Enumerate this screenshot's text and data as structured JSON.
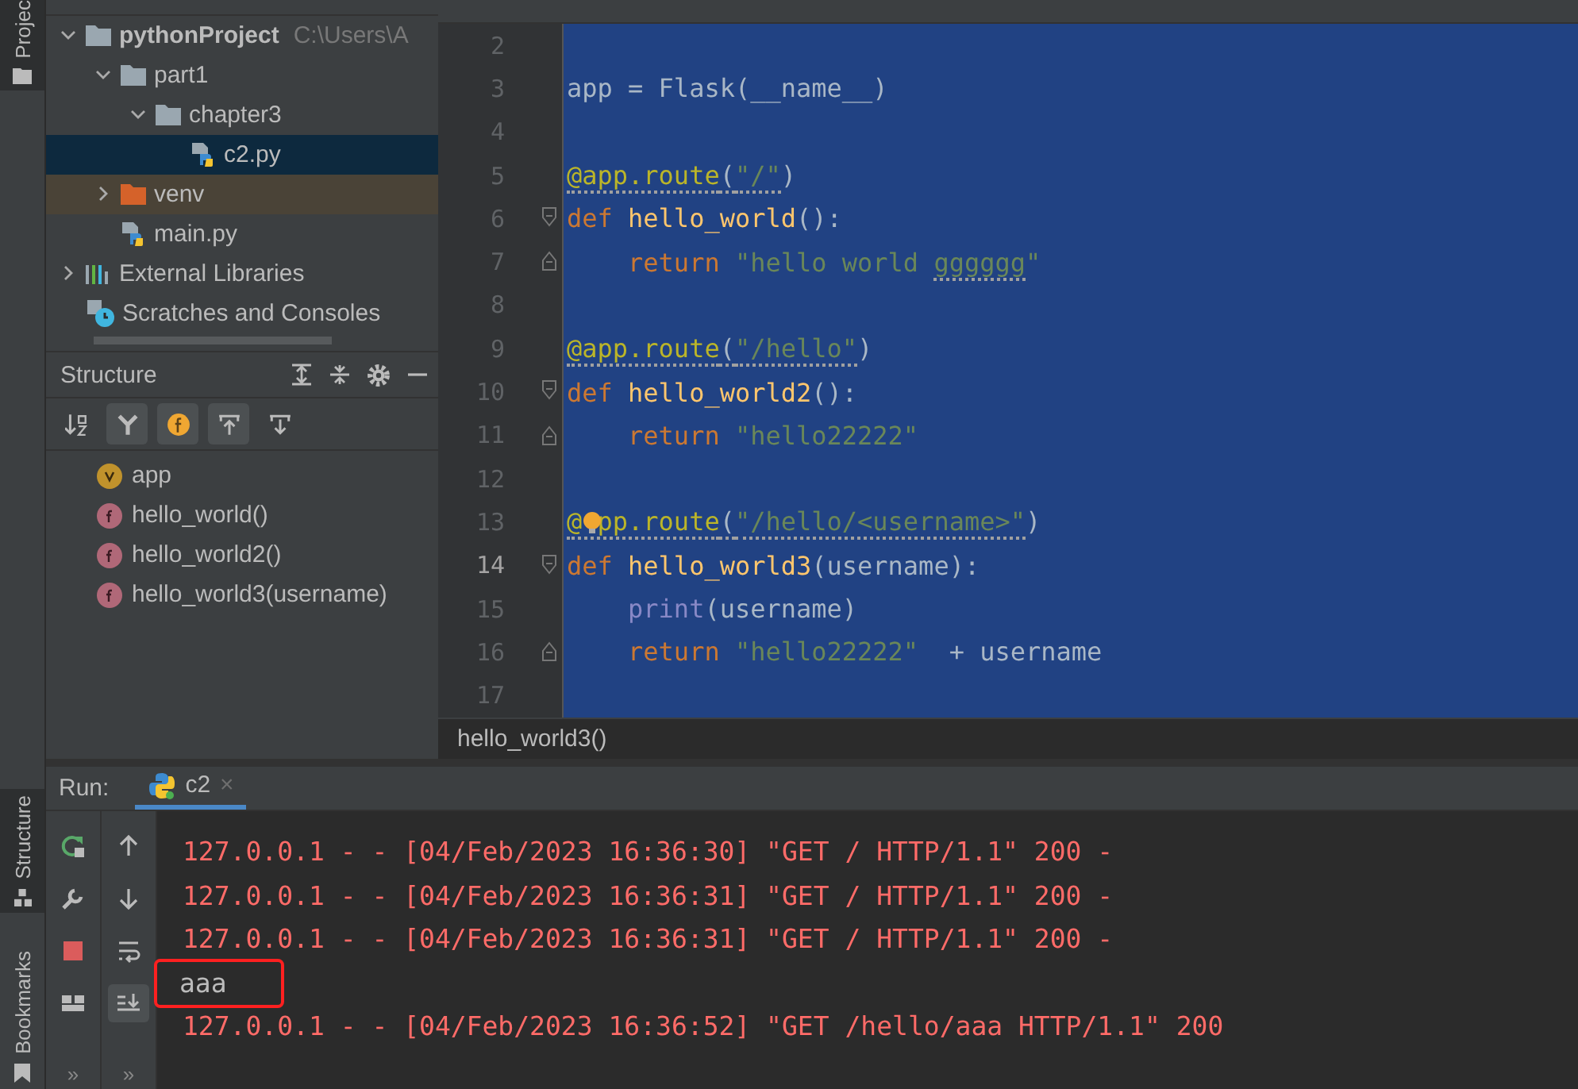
{
  "side_strip": {
    "tabs": [
      {
        "label": "Projec",
        "kind": "project",
        "selected": true
      },
      {
        "label": "Structure",
        "kind": "structure",
        "selected": true
      },
      {
        "label": "Bookmarks",
        "kind": "bookmarks",
        "selected": false
      }
    ]
  },
  "project_tree": {
    "items": [
      {
        "label": "pythonProject",
        "hint": "C:\\Users\\A",
        "kind": "folder",
        "expanded": true,
        "selected": false,
        "children": [
          {
            "label": "part1",
            "kind": "folder",
            "expanded": true,
            "selected": false,
            "children": [
              {
                "label": "chapter3",
                "kind": "folder",
                "expanded": true,
                "selected": false,
                "children": [
                  {
                    "label": "c2.py",
                    "kind": "python-file",
                    "selected": true
                  }
                ]
              }
            ]
          },
          {
            "label": "venv",
            "kind": "excluded-folder",
            "expanded": false,
            "selected": false
          },
          {
            "label": "main.py",
            "kind": "python-file",
            "selected": false
          }
        ]
      },
      {
        "label": "External Libraries",
        "kind": "libraries",
        "expanded": false,
        "selected": false
      },
      {
        "label": "Scratches and Consoles",
        "kind": "scratches",
        "selected": false
      }
    ]
  },
  "structure": {
    "title": "Structure",
    "toolbar": [
      {
        "kind": "sort",
        "on": false
      },
      {
        "kind": "fields",
        "on": true
      },
      {
        "kind": "functions",
        "on": true
      },
      {
        "kind": "scroll-to-source",
        "on": true
      },
      {
        "kind": "scroll-from-source",
        "on": false
      }
    ],
    "items": [
      {
        "label": "app",
        "kind": "variable"
      },
      {
        "label": "hello_world()",
        "kind": "function"
      },
      {
        "label": "hello_world2()",
        "kind": "function"
      },
      {
        "label": "hello_world3(username)",
        "kind": "function"
      }
    ]
  },
  "editor": {
    "lines": [
      {
        "number": "2",
        "selected": true,
        "current": false
      },
      {
        "number": "3",
        "selected": true,
        "current": false,
        "tokens": [
          {
            "text": "app = Flask(__name__)",
            "kind": "plain"
          }
        ]
      },
      {
        "number": "4",
        "selected": true,
        "current": false
      },
      {
        "number": "5",
        "selected": true,
        "current": false,
        "tokens": [
          {
            "text": "@app.route",
            "kind": "decorator",
            "squiggle": true
          },
          {
            "text": "(",
            "kind": "plain",
            "squiggle": true
          },
          {
            "text": "\"/\"",
            "kind": "string",
            "squiggle": true
          },
          {
            "text": ")",
            "kind": "plain"
          }
        ]
      },
      {
        "number": "6",
        "selected": true,
        "current": false,
        "fold_start": true,
        "tokens": [
          {
            "text": "def ",
            "kind": "keyword"
          },
          {
            "text": "hello_world",
            "kind": "function"
          },
          {
            "text": "():",
            "kind": "plain"
          }
        ]
      },
      {
        "number": "7",
        "selected": true,
        "current": false,
        "fold_end": true,
        "tokens": [
          {
            "text": "    return ",
            "kind": "keyword"
          },
          {
            "text": "\"hello world ",
            "kind": "string"
          },
          {
            "text": "gggggg",
            "kind": "string",
            "squiggle": true
          },
          {
            "text": "\"",
            "kind": "string"
          }
        ]
      },
      {
        "number": "8",
        "selected": true,
        "current": false
      },
      {
        "number": "9",
        "selected": true,
        "current": false,
        "tokens": [
          {
            "text": "@app.route",
            "kind": "decorator",
            "squiggle": true
          },
          {
            "text": "(",
            "kind": "plain",
            "squiggle": true
          },
          {
            "text": "\"/hello\"",
            "kind": "string",
            "squiggle": true
          },
          {
            "text": ")",
            "kind": "plain"
          }
        ]
      },
      {
        "number": "10",
        "selected": true,
        "current": false,
        "fold_start": true,
        "tokens": [
          {
            "text": "def ",
            "kind": "keyword"
          },
          {
            "text": "hello_world2",
            "kind": "function"
          },
          {
            "text": "():",
            "kind": "plain"
          }
        ]
      },
      {
        "number": "11",
        "selected": true,
        "current": false,
        "fold_end": true,
        "tokens": [
          {
            "text": "    return ",
            "kind": "keyword"
          },
          {
            "text": "\"hello22222\"",
            "kind": "string"
          }
        ]
      },
      {
        "number": "12",
        "selected": true,
        "current": false
      },
      {
        "number": "13",
        "selected": true,
        "current": false,
        "bulb": true,
        "tokens": [
          {
            "text": "@ pp.route",
            "kind": "decorator",
            "squiggle": true
          },
          {
            "text": "(",
            "kind": "plain",
            "squiggle": true
          },
          {
            "text": "\"/hello/<username>\"",
            "kind": "string",
            "squiggle": true
          },
          {
            "text": ")",
            "kind": "plain"
          }
        ]
      },
      {
        "number": "14",
        "selected": true,
        "current": true,
        "fold_start": true,
        "tokens": [
          {
            "text": "def ",
            "kind": "keyword"
          },
          {
            "text": "hello_world3",
            "kind": "function"
          },
          {
            "text": "(username):",
            "kind": "plain"
          }
        ]
      },
      {
        "number": "15",
        "selected": true,
        "current": false,
        "tokens": [
          {
            "text": "    print",
            "kind": "builtin"
          },
          {
            "text": "(username)",
            "kind": "plain"
          }
        ]
      },
      {
        "number": "16",
        "selected": true,
        "current": false,
        "fold_end": true,
        "tokens": [
          {
            "text": "    return ",
            "kind": "keyword"
          },
          {
            "text": "\"hello22222\"",
            "kind": "string"
          },
          {
            "text": "  + username",
            "kind": "plain"
          }
        ]
      },
      {
        "number": "17",
        "selected": true,
        "current": false
      }
    ],
    "breadcrumb": "hello_world3()"
  },
  "run": {
    "label": "Run:",
    "tabs": [
      {
        "label": "c2",
        "close": "×",
        "selected": true
      }
    ],
    "left_toolbar": [
      {
        "kind": "rerun"
      },
      {
        "kind": "settings"
      },
      {
        "kind": "stop"
      },
      {
        "kind": "layout"
      },
      {
        "kind": "more",
        "text": "»"
      }
    ],
    "right_toolbar": [
      {
        "kind": "up",
        "on": false
      },
      {
        "kind": "down",
        "on": false
      },
      {
        "kind": "wrap",
        "on": false
      },
      {
        "kind": "scroll-end",
        "on": true
      },
      {
        "kind": "more",
        "text": "»"
      }
    ],
    "console": [
      {
        "text": "127.0.0.1 - - [04/Feb/2023 16:36:30] \"GET / HTTP/1.1\" 200 -",
        "kind": "stderr",
        "highlighted": false
      },
      {
        "text": "127.0.0.1 - - [04/Feb/2023 16:36:31] \"GET / HTTP/1.1\" 200 -",
        "kind": "stderr",
        "highlighted": false
      },
      {
        "text": "127.0.0.1 - - [04/Feb/2023 16:36:31] \"GET / HTTP/1.1\" 200 -",
        "kind": "stderr",
        "highlighted": false
      },
      {
        "text": "aaa",
        "kind": "stdout",
        "highlighted": true
      },
      {
        "text": "127.0.0.1 - - [04/Feb/2023 16:36:52] \"GET /hello/aaa HTTP/1.1\" 200",
        "kind": "stderr",
        "highlighted": false
      }
    ]
  }
}
